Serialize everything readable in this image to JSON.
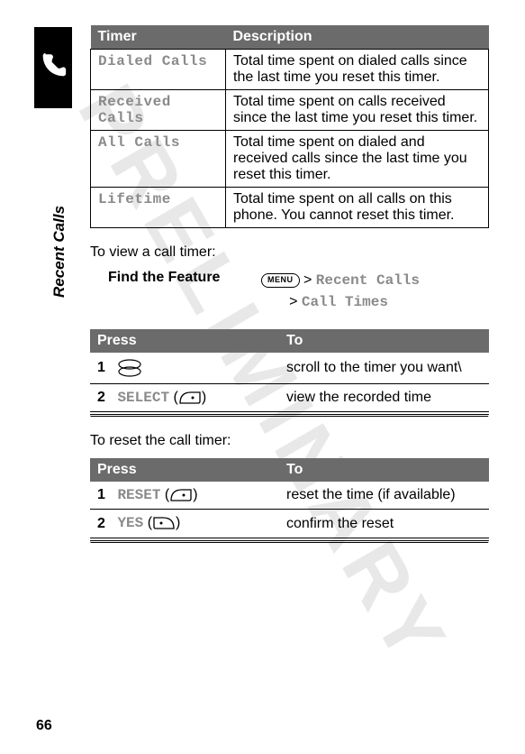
{
  "section_label": "Recent Calls",
  "watermark": "PRELIMINARY",
  "page_number": "66",
  "timer_table": {
    "headers": [
      "Timer",
      "Description"
    ],
    "rows": [
      {
        "label": "Dialed Calls",
        "desc": "Total time spent on dialed calls since the last time you reset this timer."
      },
      {
        "label": "Received Calls",
        "desc": "Total time spent on calls received since the last time you reset this timer."
      },
      {
        "label": "All Calls",
        "desc": "Total time spent on dialed and received calls since the last time you reset this timer."
      },
      {
        "label": "Lifetime",
        "desc": "Total time spent on all calls on this phone. You cannot reset this timer."
      }
    ]
  },
  "view_intro": "To view a call timer:",
  "find_feature_label": "Find the Feature",
  "menu_badge_text": "MENU",
  "feature_path": {
    "line1_sep": ">",
    "line1_text": "Recent Calls",
    "line2_sep": ">",
    "line2_text": "Call Times"
  },
  "press_table1": {
    "headers": [
      "Press",
      "To"
    ],
    "rows": [
      {
        "step": "1",
        "key_label": "",
        "icon": "updown",
        "action": "scroll to the timer you want\\"
      },
      {
        "step": "2",
        "key_label": "SELECT",
        "icon": "soft-right",
        "paren_open": "(",
        "paren_close": ")",
        "action": "view the recorded time"
      }
    ]
  },
  "reset_intro": "To reset the call timer:",
  "press_table2": {
    "headers": [
      "Press",
      "To"
    ],
    "rows": [
      {
        "step": "1",
        "key_label": "RESET",
        "icon": "soft-right",
        "paren_open": "(",
        "paren_close": ")",
        "action": "reset the time (if available)"
      },
      {
        "step": "2",
        "key_label": "YES",
        "icon": "soft-left",
        "paren_open": "(",
        "paren_close": ")",
        "action": "confirm the reset"
      }
    ]
  }
}
